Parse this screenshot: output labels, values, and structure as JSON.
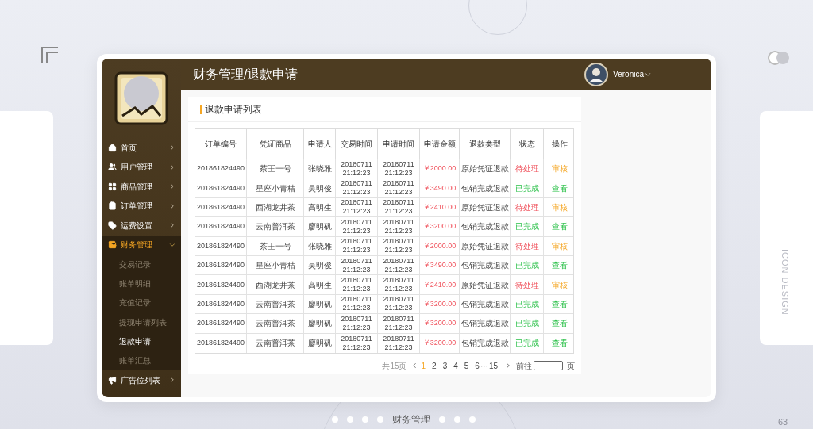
{
  "header": {
    "title": "财务管理/退款申请",
    "user": "Veronica"
  },
  "sidebar": {
    "items": [
      {
        "kind": "home",
        "label": "首页",
        "selected": false,
        "expanded": false
      },
      {
        "kind": "users",
        "label": "用户管理",
        "selected": false,
        "expanded": false
      },
      {
        "kind": "goods",
        "label": "商品管理",
        "selected": false,
        "expanded": false
      },
      {
        "kind": "orders",
        "label": "订单管理",
        "selected": false,
        "expanded": false
      },
      {
        "kind": "tag",
        "label": "运费设置",
        "selected": false,
        "expanded": false
      },
      {
        "kind": "wallet",
        "label": "财务管理",
        "selected": true,
        "expanded": true,
        "children": [
          {
            "label": "交易记录",
            "selected": false
          },
          {
            "label": "账单明细",
            "selected": false
          },
          {
            "label": "充值记录",
            "selected": false
          },
          {
            "label": "提现申请列表",
            "selected": false
          },
          {
            "label": "退款申请",
            "selected": true
          },
          {
            "label": "账单汇总",
            "selected": false
          }
        ]
      },
      {
        "kind": "ads",
        "label": "广告位列表",
        "selected": false,
        "expanded": false
      }
    ]
  },
  "card": {
    "title": "退款申请列表"
  },
  "table": {
    "columns": [
      "订单编号",
      "凭证商品",
      "申请人",
      "交易时间",
      "申请时间",
      "申请金额",
      "退款类型",
      "状态",
      "操作"
    ],
    "rows": [
      {
        "kind": "pending",
        "cells": [
          "201861824490",
          "茶王一号",
          "张晓雅",
          "20180711 21:12:23",
          "20180711 21:12:23",
          "￥2000.00",
          "原始凭证退款",
          "待处理",
          "审核"
        ]
      },
      {
        "kind": "done",
        "cells": [
          "201861824490",
          "星座小青桔",
          "吴明俊",
          "20180711 21:12:23",
          "20180711 21:12:23",
          "￥3490.00",
          "包销完成退款",
          "已完成",
          "查看"
        ]
      },
      {
        "kind": "pending",
        "cells": [
          "201861824490",
          "西湖龙井茶",
          "高明生",
          "20180711 21:12:23",
          "20180711 21:12:23",
          "￥2410.00",
          "原始凭证退款",
          "待处理",
          "审核"
        ]
      },
      {
        "kind": "done",
        "cells": [
          "201861824490",
          "云南普洱茶",
          "廖明矾",
          "20180711 21:12:23",
          "20180711 21:12:23",
          "￥3200.00",
          "包销完成退款",
          "已完成",
          "查看"
        ]
      },
      {
        "kind": "pending",
        "cells": [
          "201861824490",
          "茶王一号",
          "张晓雅",
          "20180711 21:12:23",
          "20180711 21:12:23",
          "￥2000.00",
          "原始凭证退款",
          "待处理",
          "审核"
        ]
      },
      {
        "kind": "done",
        "cells": [
          "201861824490",
          "星座小青桔",
          "吴明俊",
          "20180711 21:12:23",
          "20180711 21:12:23",
          "￥3490.00",
          "包销完成退款",
          "已完成",
          "查看"
        ]
      },
      {
        "kind": "pending",
        "cells": [
          "201861824490",
          "西湖龙井茶",
          "高明生",
          "20180711 21:12:23",
          "20180711 21:12:23",
          "￥2410.00",
          "原始凭证退款",
          "待处理",
          "审核"
        ]
      },
      {
        "kind": "done",
        "cells": [
          "201861824490",
          "云南普洱茶",
          "廖明矾",
          "20180711 21:12:23",
          "20180711 21:12:23",
          "￥3200.00",
          "包销完成退款",
          "已完成",
          "查看"
        ]
      },
      {
        "kind": "done",
        "cells": [
          "201861824490",
          "云南普洱茶",
          "廖明矾",
          "20180711 21:12:23",
          "20180711 21:12:23",
          "￥3200.00",
          "包销完成退款",
          "已完成",
          "查看"
        ]
      },
      {
        "kind": "done",
        "cells": [
          "201861824490",
          "云南普洱茶",
          "廖明矾",
          "20180711 21:12:23",
          "20180711 21:12:23",
          "￥3200.00",
          "包销完成退款",
          "已完成",
          "查看"
        ]
      }
    ]
  },
  "pagination": {
    "total": "共15页",
    "pages": [
      {
        "label": "1",
        "selected": true
      },
      {
        "label": "2",
        "selected": false
      },
      {
        "label": "3",
        "selected": false
      },
      {
        "label": "4",
        "selected": false
      },
      {
        "label": "5",
        "selected": false
      },
      {
        "label": "6",
        "selected": false
      },
      {
        "label": "···",
        "selected": false
      },
      {
        "label": "15",
        "selected": false
      }
    ],
    "goto": "前往",
    "unit": "页"
  },
  "presentation": {
    "side_label": "ICON DESIGN",
    "page_number": "63",
    "caption": "财务管理"
  }
}
